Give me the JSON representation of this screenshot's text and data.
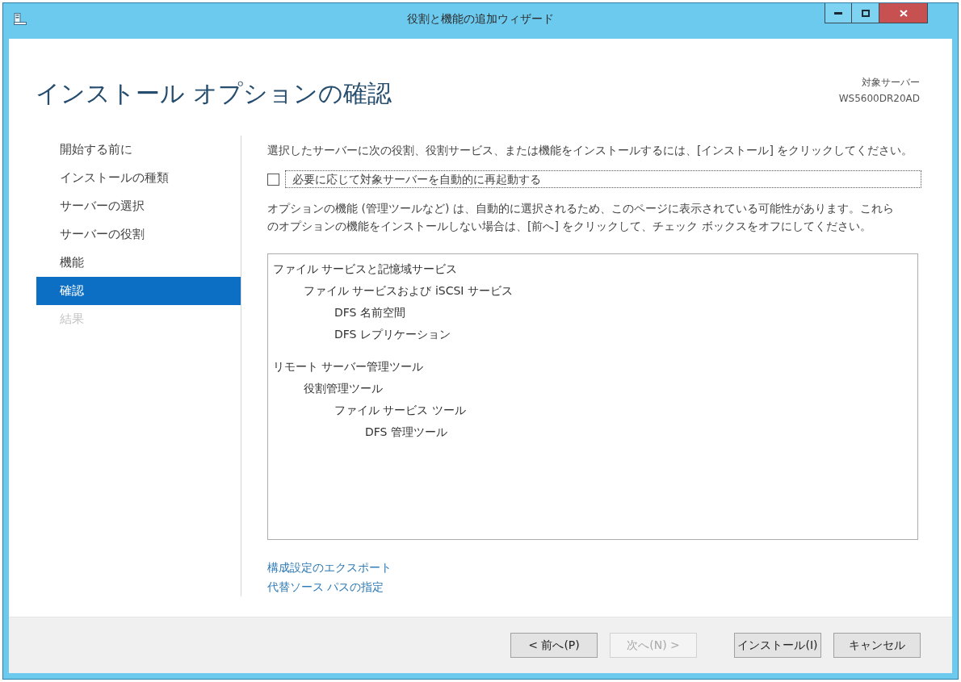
{
  "window": {
    "title": "役割と機能の追加ウィザード"
  },
  "header": {
    "heading": "インストール オプションの確認",
    "target_server": {
      "label": "対象サーバー",
      "value": "WS5600DR20AD"
    }
  },
  "sidebar": {
    "items": [
      {
        "label": "開始する前に",
        "selected": false,
        "disabled": false
      },
      {
        "label": "インストールの種類",
        "selected": false,
        "disabled": false
      },
      {
        "label": "サーバーの選択",
        "selected": false,
        "disabled": false
      },
      {
        "label": "サーバーの役割",
        "selected": false,
        "disabled": false
      },
      {
        "label": "機能",
        "selected": false,
        "disabled": false
      },
      {
        "label": "確認",
        "selected": true,
        "disabled": false
      },
      {
        "label": "結果",
        "selected": false,
        "disabled": true
      }
    ]
  },
  "content": {
    "intro": "選択したサーバーに次の役割、役割サービス、または機能をインストールするには、[インストール] をクリックしてください。",
    "restart_checkbox": {
      "label": "必要に応じて対象サーバーを自動的に再起動する",
      "checked": false,
      "focused": true
    },
    "note": "オプションの機能 (管理ツールなど) は、自動的に選択されるため、このページに表示されている可能性があります。これらのオプションの機能をインストールしない場合は、[前へ] をクリックして、チェック ボックスをオフにしてください。",
    "features": [
      {
        "label": "ファイル サービスと記憶域サービス",
        "children": [
          {
            "label": "ファイル サービスおよび iSCSI サービス",
            "children": [
              {
                "label": "DFS 名前空間"
              },
              {
                "label": "DFS レプリケーション"
              }
            ]
          }
        ]
      },
      {
        "label": "リモート サーバー管理ツール",
        "children": [
          {
            "label": "役割管理ツール",
            "children": [
              {
                "label": "ファイル サービス ツール",
                "children": [
                  {
                    "label": "DFS 管理ツール"
                  }
                ]
              }
            ]
          }
        ]
      }
    ],
    "links": [
      "構成設定のエクスポート",
      "代替ソース パスの指定"
    ]
  },
  "navigation_buttons": [
    {
      "label": "< 前へ(P)",
      "disabled": false
    },
    {
      "label": "次へ(N) >",
      "disabled": true
    }
  ],
  "action_buttons": [
    {
      "label": "インストール(I)",
      "disabled": false
    },
    {
      "label": "キャンセル",
      "disabled": false
    }
  ]
}
